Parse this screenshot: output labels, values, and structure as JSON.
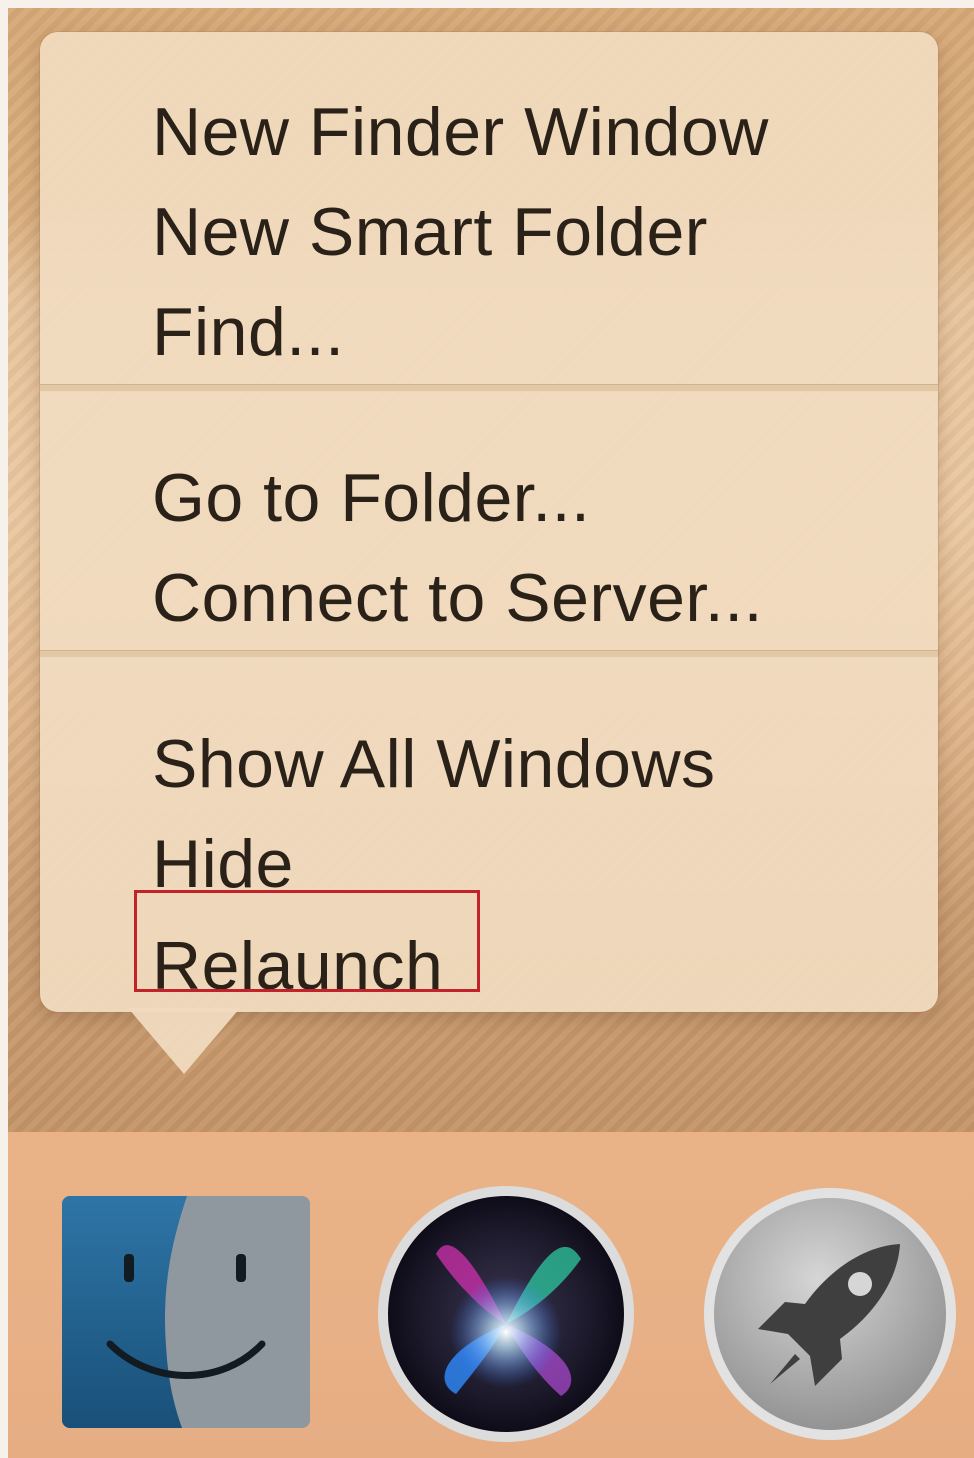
{
  "context_menu": {
    "items": [
      {
        "label": "New Finder Window"
      },
      {
        "label": "New Smart Folder"
      },
      {
        "label": "Find..."
      },
      {
        "label": "Go to Folder..."
      },
      {
        "label": "Connect to Server..."
      },
      {
        "label": "Show All Windows"
      },
      {
        "label": "Hide"
      },
      {
        "label": "Relaunch"
      }
    ],
    "highlighted_item": "Relaunch",
    "highlight_color": "#c2222a"
  },
  "dock": {
    "apps": [
      {
        "name": "Finder",
        "icon": "finder-icon"
      },
      {
        "name": "Siri",
        "icon": "siri-icon"
      },
      {
        "name": "Launchpad",
        "icon": "launchpad-icon"
      }
    ]
  },
  "colors": {
    "menu_bg": "#f1dcc0",
    "menu_text": "#2a2118",
    "dock_bg": "#eab387"
  }
}
